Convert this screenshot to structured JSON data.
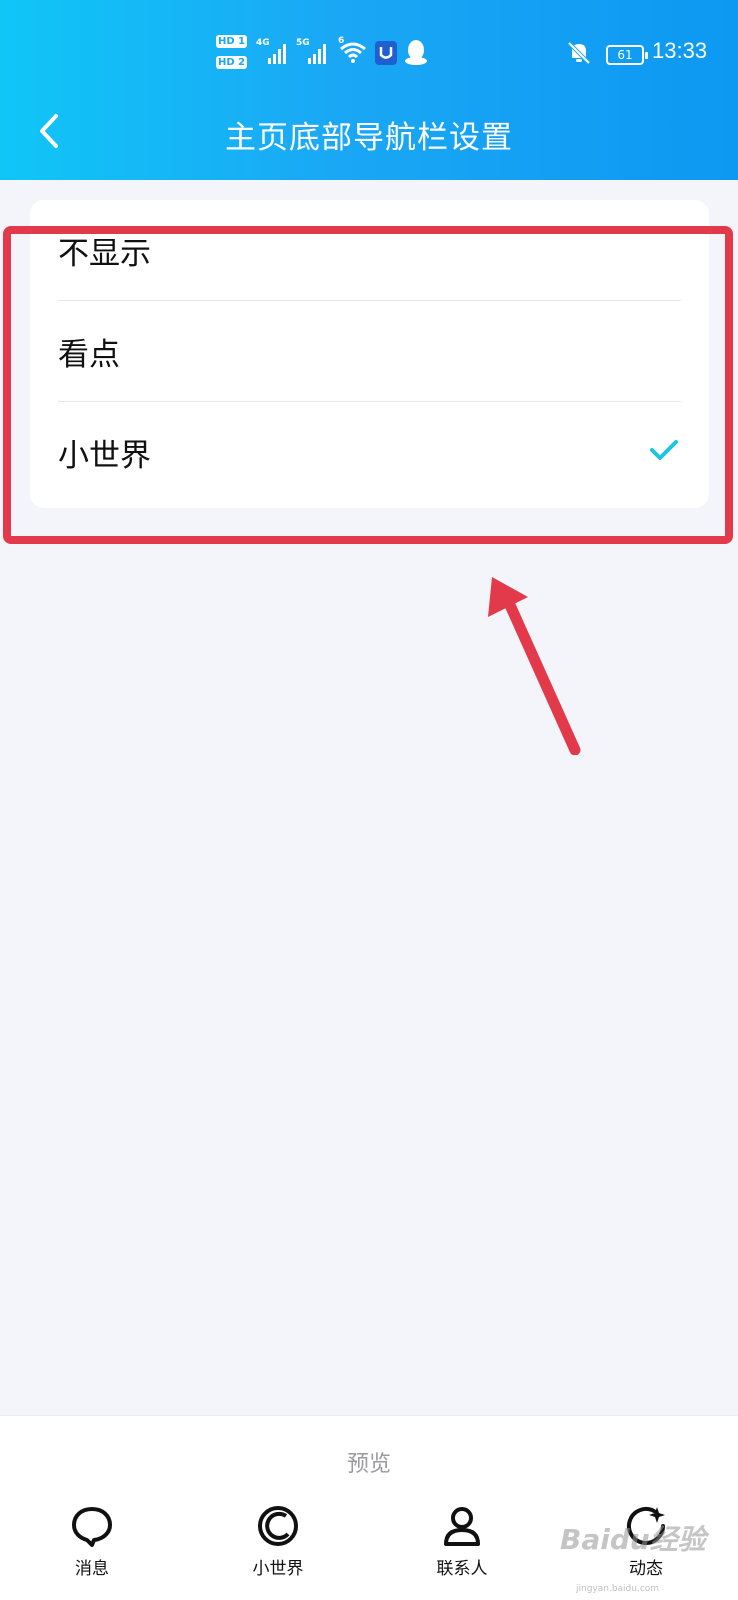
{
  "status_bar": {
    "hd1": "HD 1",
    "hd2": "HD 2",
    "network1": "4G",
    "network2": "5G",
    "wifi_tag": "6",
    "battery": "61",
    "time": "13:33",
    "icons": [
      "signal-icon",
      "wifi-icon",
      "shield-app-icon",
      "qq-penguin-icon",
      "mute-bell-icon",
      "battery-icon"
    ]
  },
  "header": {
    "title": "主页底部导航栏设置",
    "back_icon": "chevron-left-icon"
  },
  "options": [
    {
      "label": "不显示",
      "selected": false
    },
    {
      "label": "看点",
      "selected": false
    },
    {
      "label": "小世界",
      "selected": true
    }
  ],
  "preview": {
    "label": "预览",
    "nav_items": [
      {
        "label": "消息",
        "icon": "message-bubble-icon"
      },
      {
        "label": "小世界",
        "icon": "world-circle-icon"
      },
      {
        "label": "联系人",
        "icon": "person-icon"
      },
      {
        "label": "动态",
        "icon": "activity-star-icon"
      }
    ]
  },
  "watermark": {
    "text": "Baidu经验",
    "sub": "jingyan.baidu.com"
  },
  "colors": {
    "header_gradient_start": "#10c6f7",
    "header_gradient_end": "#0d98f2",
    "check": "#1cc4e6",
    "annotation": "#e23a4b",
    "background": "#f4f5fa"
  }
}
